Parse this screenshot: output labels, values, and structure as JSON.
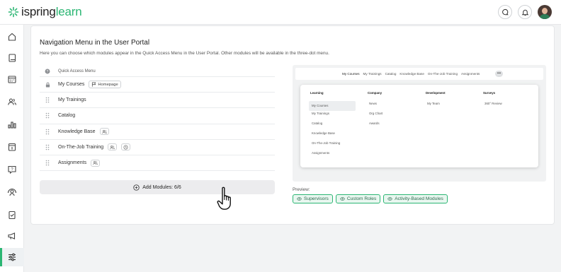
{
  "app": {
    "logo_prefix": "ispring",
    "logo_suffix": "learn",
    "brand_color": "#2bb673"
  },
  "topbar": {
    "icons": [
      "chat-icon",
      "bell-icon",
      "user-avatar"
    ]
  },
  "sidebar": {
    "items": [
      {
        "name": "home-icon"
      },
      {
        "name": "book-icon"
      },
      {
        "name": "calendar-icon"
      },
      {
        "name": "users-icon"
      },
      {
        "name": "chart-icon"
      },
      {
        "name": "one-on-one-icon"
      },
      {
        "name": "question-icon"
      },
      {
        "name": "org-icon"
      },
      {
        "name": "clipboard-icon"
      },
      {
        "name": "megaphone-icon"
      },
      {
        "name": "settings-sliders-icon",
        "active": true
      }
    ]
  },
  "page": {
    "title": "Navigation Menu in the User Portal",
    "subtitle": "Here you can choose which modules appear in the Quick Access Menu in the User Portal. Other modules will be available in the three-dot menu."
  },
  "modules": {
    "header": "Quick Access Menu",
    "items": [
      {
        "label": "My Courses",
        "tag": "Homepage",
        "locked": true
      },
      {
        "label": "My Trainings"
      },
      {
        "label": "Catalog"
      },
      {
        "label": "Knowledge Base",
        "badges": [
          "people"
        ]
      },
      {
        "label": "On-The-Job Training",
        "badges": [
          "people",
          "clock"
        ]
      },
      {
        "label": "Assignments",
        "badges": [
          "people"
        ]
      }
    ],
    "add_button": "Add Modules: 6/6"
  },
  "preview": {
    "tabs": [
      "My Courses",
      "My Trainings",
      "Catalog",
      "Knowledge Base",
      "On-The-Job Training",
      "Assignments"
    ],
    "more": "•••",
    "columns": [
      {
        "heading": "Learning",
        "items": [
          "My Courses",
          "My Trainings",
          "Catalog",
          "Knowledge Base",
          "On-The-Job Training",
          "Assignments"
        ]
      },
      {
        "heading": "Company",
        "items": [
          "News",
          "Org Chart",
          "Awards"
        ]
      },
      {
        "heading": "Development",
        "items": [
          "My Team"
        ]
      },
      {
        "heading": "Surveys",
        "items": [
          "360° Review"
        ]
      }
    ],
    "label": "Preview:",
    "chips": [
      "Supervisors",
      "Custom Roles",
      "Activity-Based Modules"
    ]
  }
}
